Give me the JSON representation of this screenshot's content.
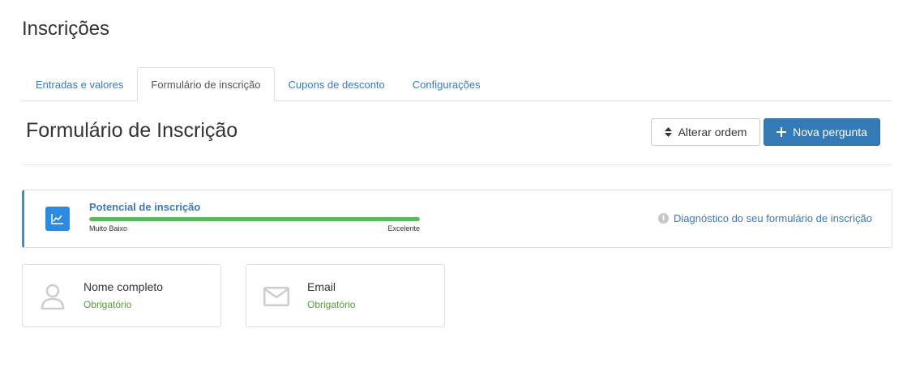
{
  "page": {
    "title": "Inscrições"
  },
  "tabs": [
    {
      "label": "Entradas e valores",
      "active": false
    },
    {
      "label": "Formulário de inscrição",
      "active": true
    },
    {
      "label": "Cupons de desconto",
      "active": false
    },
    {
      "label": "Configurações",
      "active": false
    }
  ],
  "section": {
    "title": "Formulário de Inscrição",
    "reorder_button": {
      "label": "Alterar ordem",
      "icon": "sort-icon"
    },
    "new_question_button": {
      "label": "Nova pergunta",
      "icon": "plus-icon"
    }
  },
  "potential": {
    "title": "Potencial de inscrição",
    "icon": "line-chart-icon",
    "level": 1.0,
    "scale_low": "Muito Baixo",
    "scale_high": "Excelente",
    "diagnostic_link": "Diagnóstico do seu formulário de inscrição",
    "diagnostic_icon": "info-icon"
  },
  "fields": [
    {
      "name": "Nome completo",
      "status": "Obrigatório",
      "icon": "user-icon"
    },
    {
      "name": "Email",
      "status": "Obrigatório",
      "icon": "envelope-icon"
    }
  ],
  "colors": {
    "accent": "#337ab7",
    "link": "#3a7ab8",
    "success_bar": "#5cb85c",
    "required_text": "#5a9a3a"
  }
}
